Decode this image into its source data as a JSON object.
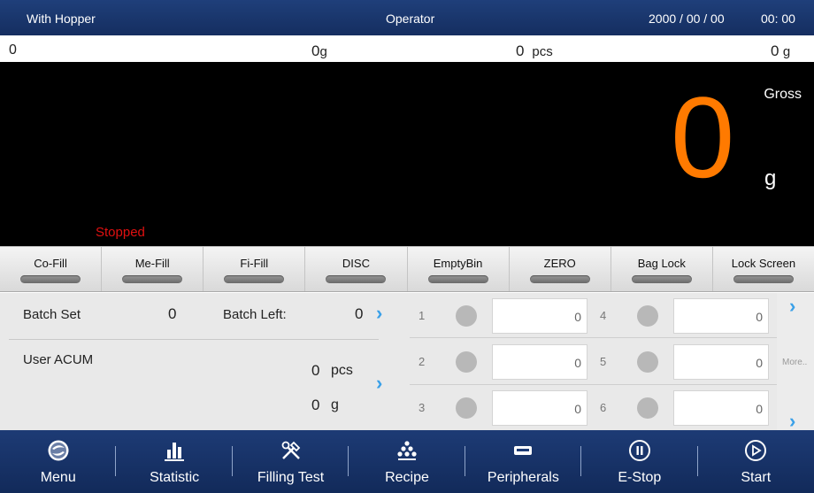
{
  "titlebar": {
    "mode": "With Hopper",
    "user": "Operator",
    "date": "2000 / 00 / 00",
    "time": "00: 00"
  },
  "inforow": {
    "count": "0",
    "weight_value": "0",
    "weight_unit": "g",
    "pcs_value": "0",
    "pcs_unit": "pcs",
    "total_value": "0",
    "total_unit": "g"
  },
  "display": {
    "mode": "Gross",
    "value": "0",
    "unit": "g",
    "status": "Stopped",
    "value_color": "#ff7a00",
    "status_color": "#e01010"
  },
  "function_keys": [
    "Co-Fill",
    "Me-Fill",
    "Fi-Fill",
    "DISC",
    "EmptyBin",
    "ZERO",
    "Bag Lock",
    "Lock Screen"
  ],
  "batch": {
    "batch_set_label": "Batch Set",
    "batch_set_value": "0",
    "batch_left_label": "Batch Left:",
    "batch_left_value": "0",
    "user_acum_label": "User ACUM",
    "acum_pcs_value": "0",
    "acum_pcs_unit": "pcs",
    "acum_g_value": "0",
    "acum_g_unit": "g"
  },
  "channels": [
    {
      "num": "1",
      "value": "0"
    },
    {
      "num": "4",
      "value": "0"
    },
    {
      "num": "2",
      "value": "0"
    },
    {
      "num": "5",
      "value": "0"
    },
    {
      "num": "3",
      "value": "0"
    },
    {
      "num": "6",
      "value": "0"
    }
  ],
  "more_label": "More..",
  "nav": [
    {
      "label": "Menu",
      "icon": "menu-logo-icon"
    },
    {
      "label": "Statistic",
      "icon": "bar-chart-icon"
    },
    {
      "label": "Filling Test",
      "icon": "tools-icon"
    },
    {
      "label": "Recipe",
      "icon": "recipe-dots-icon"
    },
    {
      "label": "Peripherals",
      "icon": "device-icon"
    },
    {
      "label": "E-Stop",
      "icon": "pause-circle-icon"
    },
    {
      "label": "Start",
      "icon": "play-circle-icon"
    }
  ],
  "colors": {
    "header_bg": "#1a3670",
    "accent_chevron": "#3aa0e8"
  }
}
